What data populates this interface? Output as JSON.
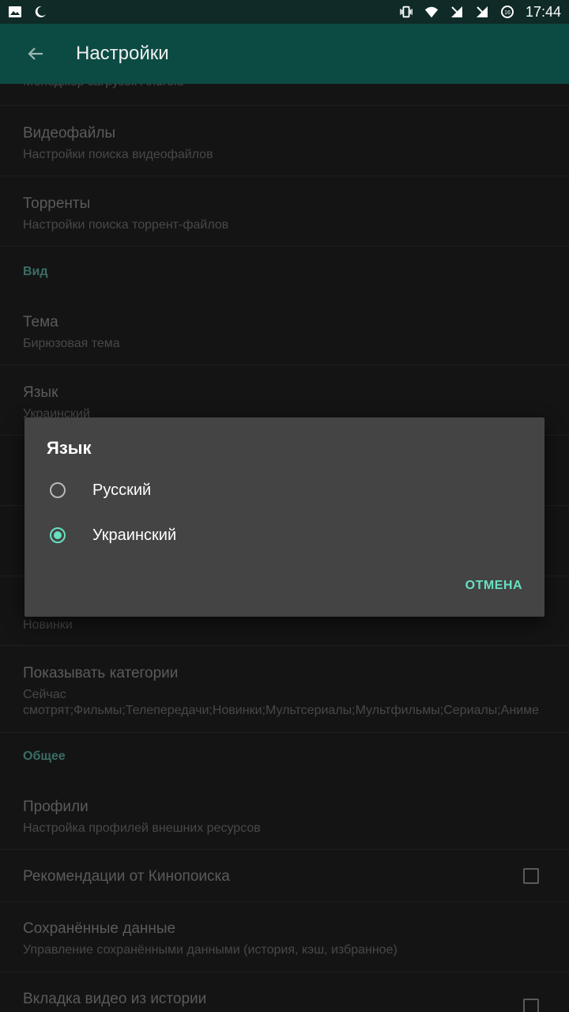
{
  "status_bar": {
    "left_icons": [
      "image-icon",
      "moon-icon"
    ],
    "right_icons": [
      "vibrate-icon",
      "wifi-icon",
      "signal-icon",
      "signal-icon-2",
      "battery-icon"
    ],
    "time": "17:44"
  },
  "app_bar": {
    "title": "Настройки",
    "back_icon": "arrow-back-icon"
  },
  "list": {
    "partial_top_subtitle": "Менеджер загрузок Android",
    "items": [
      {
        "title": "Видеофайлы",
        "subtitle": "Настройки поиска видеофайлов"
      },
      {
        "title": "Торренты",
        "subtitle": "Настройки поиска торрент-файлов"
      },
      {
        "title": "Тема",
        "subtitle": "Бирюзовая тема"
      },
      {
        "title": "Язык",
        "subtitle": "Украинский"
      },
      {
        "title": "",
        "subtitle": "Новинки"
      },
      {
        "title": "Показывать категории",
        "subtitle": "Сейчас смотрят;Фильмы;Телепередачи;Новинки;Мультсериалы;Мультфильмы;Сериалы;Аниме"
      },
      {
        "title": "Профили",
        "subtitle": "Настройка профилей внешних ресурсов"
      },
      {
        "title": "Рекомендации от Кинопоиска",
        "checked": false
      },
      {
        "title": "Сохранённые данные",
        "subtitle": "Управление сохранёнными данными (история, кэш, избранное)"
      },
      {
        "title": "Вкладка видео из истории",
        "checked": false
      }
    ],
    "sections": {
      "view": "Вид",
      "general": "Общее"
    }
  },
  "dialog": {
    "title": "Язык",
    "options": [
      {
        "label": "Русский",
        "selected": false
      },
      {
        "label": "Украинский",
        "selected": true
      }
    ],
    "cancel_label": "ОТМЕНА"
  },
  "colors": {
    "accent": "#67e0c2",
    "appbar": "#0c4b43",
    "statusbar": "#0f2a27",
    "section": "#5aa89b"
  }
}
